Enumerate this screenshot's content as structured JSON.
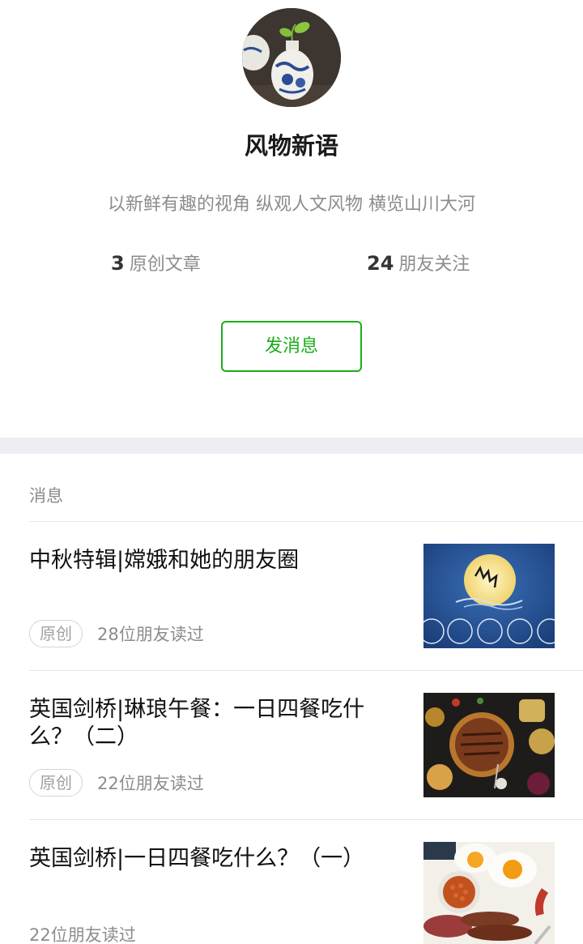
{
  "profile": {
    "name": "风物新语",
    "description": "以新鲜有趣的视角 纵观人文风物 横览山川大河",
    "stats": {
      "originals_count": "3",
      "originals_label": "原创文章",
      "followers_count": "24",
      "followers_label": "朋友关注"
    },
    "message_button": "发消息"
  },
  "messages": {
    "section_label": "消息",
    "articles": [
      {
        "title": "中秋特辑|嫦娥和她的朋友圈",
        "badge": "原创",
        "reads": "28位朋友读过"
      },
      {
        "title": "英国剑桥|琳琅午餐：一日四餐吃什么？（二）",
        "badge": "原创",
        "reads": "22位朋友读过"
      },
      {
        "title": "英国剑桥|一日四餐吃什么？（一）",
        "reads": "22位朋友读过"
      }
    ]
  },
  "colors": {
    "accent": "#1aad19",
    "muted_text": "#8c8c8c",
    "band": "#eeeef2"
  }
}
